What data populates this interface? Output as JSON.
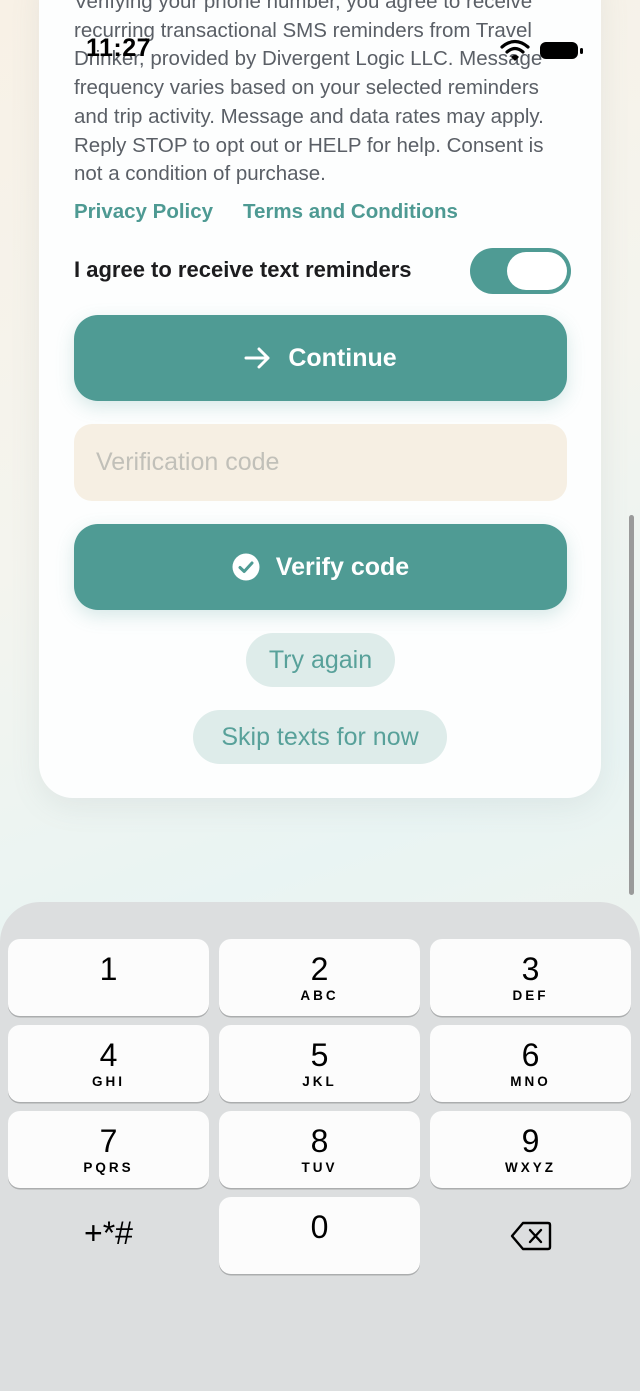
{
  "status_bar": {
    "time": "11:27"
  },
  "consent": {
    "text": "Verifying your phone number, you agree to receive recurring transactional SMS reminders from Travel Drinker, provided by Divergent Logic LLC. Message frequency varies based on your selected reminders and trip activity. Message and data rates may apply. Reply STOP to opt out or HELP for help. Consent is not a condition of purchase."
  },
  "links": {
    "privacy": "Privacy Policy",
    "terms": "Terms and Conditions"
  },
  "agree": {
    "label": "I agree to receive text reminders",
    "toggle_on": true
  },
  "continue_button": {
    "label": "Continue"
  },
  "verification_input": {
    "placeholder": "Verification code",
    "value": ""
  },
  "verify_button": {
    "label": "Verify code"
  },
  "try_again_button": {
    "label": "Try again"
  },
  "skip_button": {
    "label": "Skip texts for now"
  },
  "keypad": {
    "keys": [
      {
        "digit": "1",
        "letters": ""
      },
      {
        "digit": "2",
        "letters": "ABC"
      },
      {
        "digit": "3",
        "letters": "DEF"
      },
      {
        "digit": "4",
        "letters": "GHI"
      },
      {
        "digit": "5",
        "letters": "JKL"
      },
      {
        "digit": "6",
        "letters": "MNO"
      },
      {
        "digit": "7",
        "letters": "PQRS"
      },
      {
        "digit": "8",
        "letters": "TUV"
      },
      {
        "digit": "9",
        "letters": "WXYZ"
      },
      {
        "digit": "0",
        "letters": ""
      }
    ],
    "symbols": "+*#"
  },
  "colors": {
    "accent": "#4f9b94",
    "input_bg": "#f6efe3",
    "pill_bg": "#deecea",
    "keyboard_bg": "#dcdedf"
  }
}
